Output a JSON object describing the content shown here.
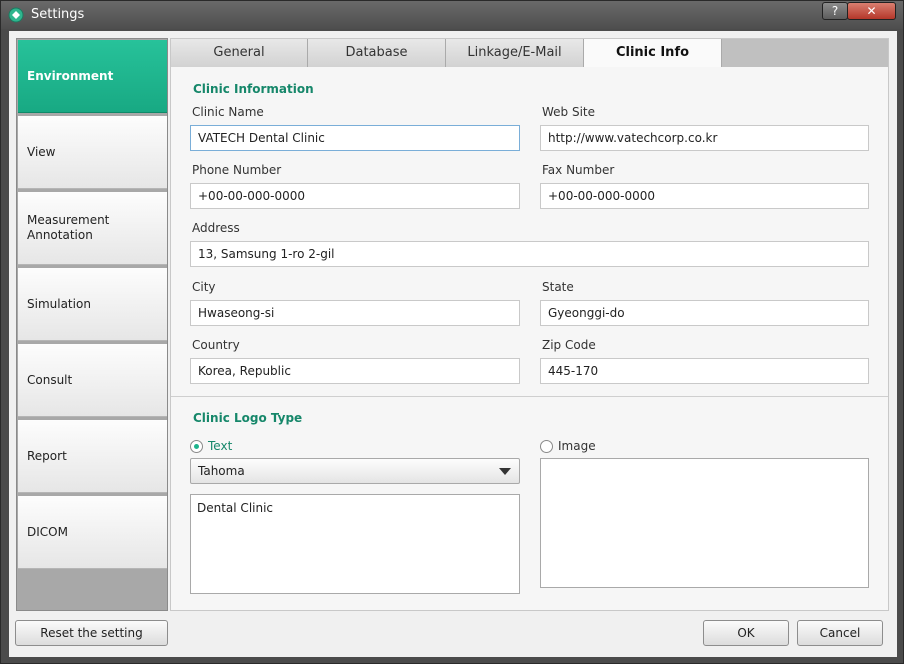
{
  "window": {
    "title": "Settings",
    "help_label": "?",
    "close_label": "✕"
  },
  "sidebar": {
    "items": [
      {
        "label": "Environment"
      },
      {
        "label": "View"
      },
      {
        "label": "Measurement Annotation"
      },
      {
        "label": "Simulation"
      },
      {
        "label": "Consult"
      },
      {
        "label": "Report"
      },
      {
        "label": "DICOM"
      }
    ],
    "active_index": 0
  },
  "tabs": [
    {
      "label": "General"
    },
    {
      "label": "Database"
    },
    {
      "label": "Linkage/E-Mail"
    },
    {
      "label": "Clinic Info"
    }
  ],
  "clinic_info": {
    "section_title": "Clinic Information",
    "clinic_name_label": "Clinic Name",
    "clinic_name": "VATECH Dental Clinic",
    "web_site_label": "Web Site",
    "web_site": "http://www.vatechcorp.co.kr",
    "phone_label": "Phone Number",
    "phone": "+00-00-000-0000",
    "fax_label": "Fax Number",
    "fax": "+00-00-000-0000",
    "address_label": "Address",
    "address": "13, Samsung 1-ro 2-gil",
    "city_label": "City",
    "city": "Hwaseong-si",
    "state_label": "State",
    "state": "Gyeonggi-do",
    "country_label": "Country",
    "country": "Korea, Republic",
    "zip_label": "Zip Code",
    "zip": "445-170"
  },
  "logo": {
    "section_title": "Clinic Logo Type",
    "text_option_label": "Text",
    "image_option_label": "Image",
    "selected": "Text",
    "font_value": "Tahoma",
    "logo_text": "Dental Clinic"
  },
  "footer": {
    "reset_label": "Reset the setting",
    "ok_label": "OK",
    "cancel_label": "Cancel"
  },
  "colors": {
    "accent": "#1eb48d",
    "section_title": "#16876a"
  }
}
